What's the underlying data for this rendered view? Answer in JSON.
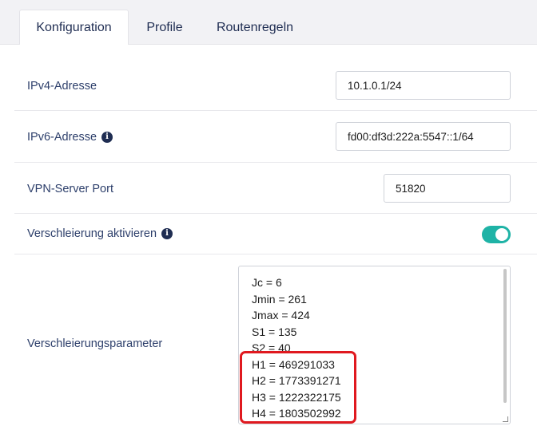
{
  "tabs": [
    {
      "label": "Konfiguration",
      "active": true
    },
    {
      "label": "Profile",
      "active": false
    },
    {
      "label": "Routenregeln",
      "active": false
    }
  ],
  "fields": {
    "ipv4": {
      "label": "IPv4-Adresse",
      "value": "10.1.0.1/24"
    },
    "ipv6": {
      "label": "IPv6-Adresse",
      "value": "fd00:df3d:222a:5547::1/64"
    },
    "port": {
      "label": "VPN-Server Port",
      "value": "51820"
    },
    "obfuscation": {
      "label": "Verschleierung aktivieren",
      "enabled": true
    },
    "params": {
      "label": "Verschleierungsparameter",
      "lines": [
        "Jc = 6",
        "Jmin = 261",
        "Jmax = 424",
        "S1 = 135",
        "S2 = 40",
        "H1 = 469291033",
        "H2 = 1773391271",
        "H3 = 1222322175",
        "H4 = 1803502992"
      ]
    }
  },
  "colors": {
    "accent": "#1fb3a6",
    "highlight": "#e0191f",
    "label": "#2d3f6b"
  },
  "icons": {
    "info": "info-icon"
  }
}
